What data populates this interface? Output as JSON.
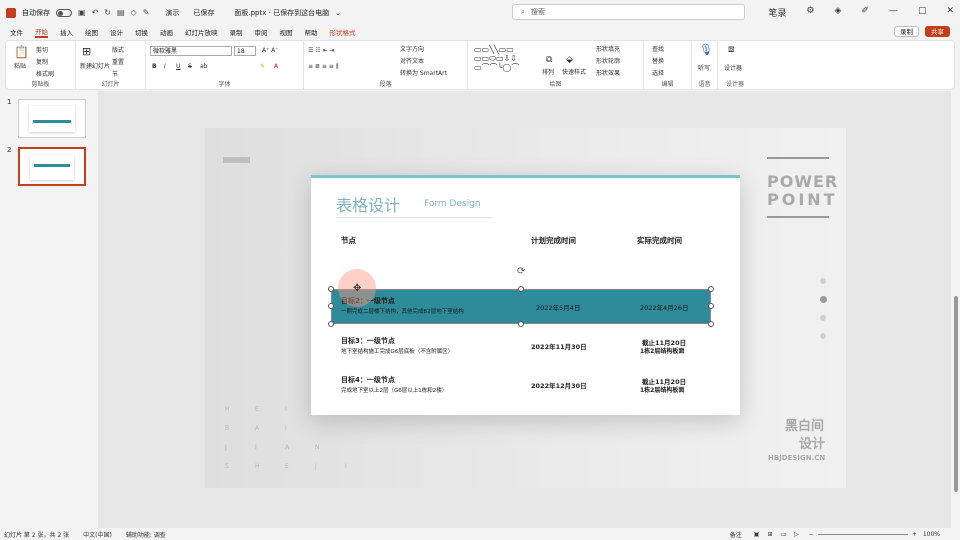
{
  "titlebar": {
    "autosave": "自动保存",
    "toggle_state": "关",
    "presenting": "演示",
    "saved": "已保存",
    "filename": "面板.pptx · 已保存到这台电脑",
    "user": "笔录"
  },
  "search": {
    "placeholder": "搜索"
  },
  "tabs": [
    "文件",
    "开始",
    "插入",
    "绘图",
    "设计",
    "切换",
    "动画",
    "幻灯片放映",
    "录制",
    "审阅",
    "视图",
    "帮助",
    "形状格式"
  ],
  "active_tab": "开始",
  "tab_right": {
    "record": "录制",
    "share": "共享"
  },
  "ribbon": {
    "clipboard": {
      "label": "剪贴板",
      "paste": "粘贴",
      "cut": "剪切",
      "copy": "复制",
      "format_painter": "格式刷"
    },
    "slides": {
      "label": "幻灯片",
      "new_slide": "新建幻灯片",
      "reuse": "重用幻灯片",
      "layout": "版式",
      "reset": "重置",
      "section": "节"
    },
    "font": {
      "label": "字体",
      "font_name": "微软雅黑",
      "font_size": "18",
      "bold": "B",
      "italic": "I",
      "underline": "U",
      "strike": "S",
      "shadow": "ab"
    },
    "paragraph": {
      "label": "段落",
      "text_direction": "文字方向",
      "align_text": "对齐文本",
      "smartart": "转换为 SmartArt"
    },
    "drawing": {
      "label": "绘图",
      "arrange": "排列",
      "quick_styles": "快速样式",
      "fill": "形状填充",
      "outline": "形状轮廓",
      "effects": "形状效果"
    },
    "editing": {
      "label": "编辑",
      "find": "查找",
      "replace": "替换",
      "select": "选择"
    },
    "voice": {
      "label": "语音",
      "dictate": "听写"
    },
    "designer": {
      "label": "设计器",
      "designer": "设计器"
    }
  },
  "thumbnails": [
    {
      "num": "1"
    },
    {
      "num": "2"
    }
  ],
  "slide": {
    "card_title": "表格设计",
    "card_subtitle": "Form Design",
    "headers": [
      "节点",
      "计划完成时间",
      "实际完成时间"
    ],
    "rows": [
      {
        "title": "目标2：一级节点",
        "desc": "一期完成二层楼下结构，其他完成B2层地下室结构",
        "planned": "2022年5月4日",
        "actual": "2022年4月26日",
        "highlight": true
      },
      {
        "title": "目标3：一级节点",
        "desc": "地下室结构施工完成G6层底板（不含附属区）",
        "planned": "2022年11月30日",
        "actual": "截止11月20日",
        "actual2": "1栋2层结构板面",
        "highlight": false
      },
      {
        "title": "目标4：一级节点",
        "desc": "完成地下室以上2层（G6层以上1栋和2楼）",
        "planned": "2022年12月30日",
        "actual": "截止11月20日",
        "actual2": "1栋2层结构板面",
        "highlight": false
      }
    ],
    "power": "POWER",
    "point": "POINT",
    "brand1": "黑白间",
    "brand2": "设计",
    "brand_url": "HBJDESIGN.CN",
    "vertical_letters": [
      [
        "H",
        "E",
        "I"
      ],
      [
        "B",
        "A",
        "I"
      ],
      [
        "J",
        "I",
        "A",
        "N"
      ],
      [
        "S",
        "H",
        "E",
        "J",
        "I"
      ]
    ]
  },
  "colors": {
    "accent": "#c43e1c",
    "teal": "#2e8b99",
    "light_teal": "#7fc3cf"
  },
  "statusbar": {
    "slide_info": "幻灯片 第 2 张，共 2 张",
    "language": "中文(中国)",
    "accessibility": "辅助功能: 调查",
    "notes": "备注",
    "zoom": "100%"
  }
}
